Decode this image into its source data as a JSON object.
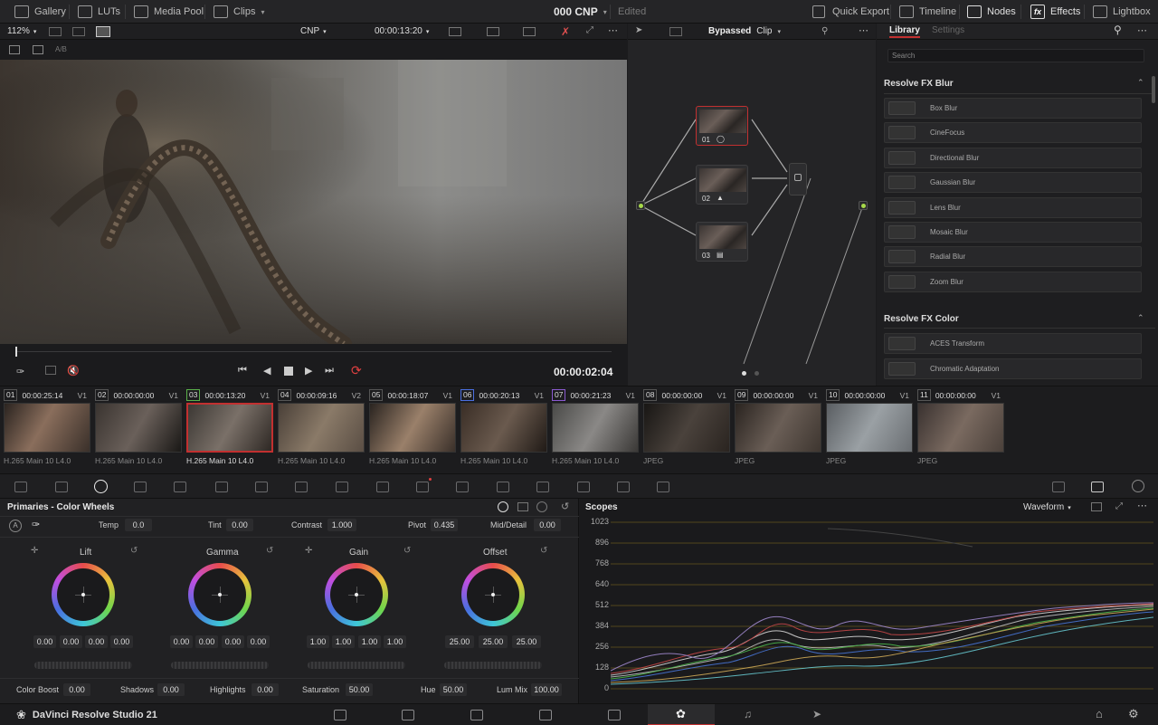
{
  "topbar": {
    "gallery": "Gallery",
    "luts": "LUTs",
    "media_pool": "Media Pool",
    "clips": "Clips",
    "project": "000 CNP",
    "status": "Edited",
    "quick_export": "Quick Export",
    "timeline": "Timeline",
    "nodes": "Nodes",
    "effects": "Effects",
    "lightbox": "Lightbox"
  },
  "viewer": {
    "zoom": "112%",
    "timeline_name": "CNP",
    "timecode": "00:00:13:20",
    "ab": "A/B",
    "playhead_timecode": "00:00:02:04"
  },
  "nodes": {
    "bypass": "Bypassed",
    "mode": "Clip",
    "list": [
      {
        "label": "01"
      },
      {
        "label": "02"
      },
      {
        "label": "03"
      }
    ]
  },
  "effects": {
    "tabs": [
      "Library",
      "Settings"
    ],
    "search_placeholder": "Search",
    "blur_section": "Resolve FX Blur",
    "blur_items": [
      "Box Blur",
      "CineFocus",
      "Directional Blur",
      "Gaussian Blur",
      "Lens Blur",
      "Mosaic Blur",
      "Radial Blur",
      "Zoom Blur"
    ],
    "color_section": "Resolve FX Color",
    "color_items": [
      "ACES Transform",
      "Chromatic Adaptation"
    ]
  },
  "clips": [
    {
      "num": "01",
      "tc": "00:00:25:14",
      "track": "V1",
      "caption": "H.265 Main 10 L4.0",
      "colored": false
    },
    {
      "num": "02",
      "tc": "00:00:00:00",
      "track": "V1",
      "caption": "H.265 Main 10 L4.0",
      "colored": false
    },
    {
      "num": "03",
      "tc": "00:00:13:20",
      "track": "V1",
      "caption": "H.265 Main 10 L4.0",
      "colored": true,
      "color": "#5ab04a"
    },
    {
      "num": "04",
      "tc": "00:00:09:16",
      "track": "V2",
      "caption": "H.265 Main 10 L4.0",
      "colored": false
    },
    {
      "num": "05",
      "tc": "00:00:18:07",
      "track": "V1",
      "caption": "H.265 Main 10 L4.0",
      "colored": false
    },
    {
      "num": "06",
      "tc": "00:00:20:13",
      "track": "V1",
      "caption": "H.265 Main 10 L4.0",
      "colored": true,
      "color": "#4a6fe0"
    },
    {
      "num": "07",
      "tc": "00:00:21:23",
      "track": "V1",
      "caption": "H.265 Main 10 L4.0",
      "colored": true,
      "color": "#8a5ad0"
    },
    {
      "num": "08",
      "tc": "00:00:00:00",
      "track": "V1",
      "caption": "JPEG",
      "colored": false
    },
    {
      "num": "09",
      "tc": "00:00:00:00",
      "track": "V1",
      "caption": "JPEG",
      "colored": false
    },
    {
      "num": "10",
      "tc": "00:00:00:00",
      "track": "V1",
      "caption": "JPEG",
      "colored": false
    },
    {
      "num": "11",
      "tc": "00:00:00:00",
      "track": "V1",
      "caption": "JPEG",
      "colored": false
    }
  ],
  "primaries": {
    "title": "Primaries - Color Wheels",
    "temp_label": "Temp",
    "temp": "0.0",
    "tint_label": "Tint",
    "tint": "0.00",
    "contrast_label": "Contrast",
    "contrast": "1.000",
    "pivot_label": "Pivot",
    "pivot": "0.435",
    "middetail_label": "Mid/Detail",
    "middetail": "0.00",
    "wheels": [
      {
        "name": "Lift",
        "values": [
          "0.00",
          "0.00",
          "0.00",
          "0.00"
        ]
      },
      {
        "name": "Gamma",
        "values": [
          "0.00",
          "0.00",
          "0.00",
          "0.00"
        ]
      },
      {
        "name": "Gain",
        "values": [
          "1.00",
          "1.00",
          "1.00",
          "1.00"
        ]
      },
      {
        "name": "Offset",
        "values": [
          "25.00",
          "25.00",
          "25.00"
        ]
      }
    ],
    "color_boost_label": "Color Boost",
    "color_boost": "0.00",
    "shadows_label": "Shadows",
    "shadows": "0.00",
    "highlights_label": "Highlights",
    "highlights": "0.00",
    "saturation_label": "Saturation",
    "saturation": "50.00",
    "hue_label": "Hue",
    "hue": "50.00",
    "lummix_label": "Lum Mix",
    "lummix": "100.00"
  },
  "scopes": {
    "title": "Scopes",
    "mode": "Waveform",
    "scale": [
      "1023",
      "896",
      "768",
      "640",
      "512",
      "384",
      "256",
      "128",
      "0"
    ]
  },
  "bottombar": {
    "app_name": "DaVinci Resolve Studio 21"
  },
  "icons": {
    "gallery": "gallery-icon",
    "luts": "luts-icon",
    "media_pool": "media-pool-icon",
    "clips": "clips-icon",
    "quick_export": "quick-export-icon",
    "timeline": "timeline-icon",
    "nodes": "nodes-icon",
    "effects": "fx-icon",
    "lightbox": "lightbox-icon"
  }
}
